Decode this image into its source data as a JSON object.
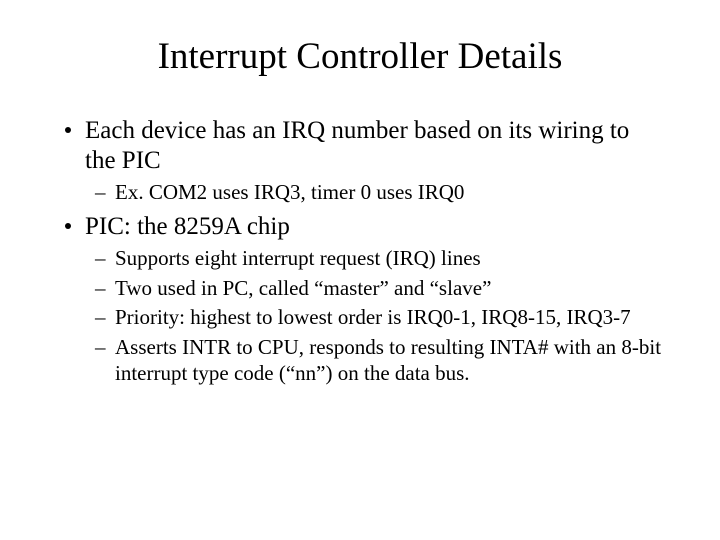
{
  "title": "Interrupt Controller Details",
  "bullets": [
    {
      "text": "Each device has an IRQ number based on its wiring to the PIC",
      "sub": [
        "Ex. COM2 uses IRQ3, timer 0 uses IRQ0"
      ]
    },
    {
      "text": "PIC: the 8259A chip",
      "sub": [
        "Supports eight interrupt request (IRQ) lines",
        "Two used in PC, called “master” and “slave”",
        "Priority: highest to lowest order is IRQ0-1, IRQ8-15, IRQ3-7",
        "Asserts INTR to CPU, responds to resulting INTA# with an 8-bit interrupt type code (“nn”) on the data bus."
      ]
    }
  ]
}
